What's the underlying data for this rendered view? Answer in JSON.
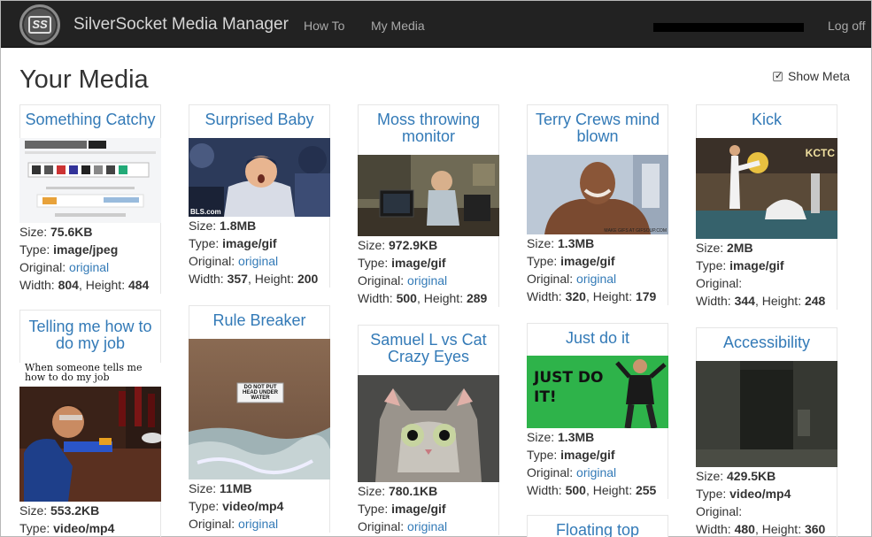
{
  "nav": {
    "logo_text": "SS",
    "brand": "SilverSocket Media Manager",
    "links": [
      "How To",
      "My Media"
    ],
    "logoff": "Log off"
  },
  "page": {
    "title": "Your Media",
    "show_meta": "Show Meta"
  },
  "labels": {
    "size": "Size:",
    "type": "Type:",
    "original": "Original:",
    "original_link": "original",
    "width": "Width:",
    "height": "Height:"
  },
  "media": [
    {
      "title": "Something Catchy",
      "size": "75.6KB",
      "type": "image/jpeg",
      "has_link": true,
      "width": "804",
      "height": "484"
    },
    {
      "title": "Surprised Baby",
      "size": "1.8MB",
      "type": "image/gif",
      "has_link": true,
      "width": "357",
      "height": "200",
      "overlay": "BLS.com"
    },
    {
      "title": "Moss throwing monitor",
      "size": "972.9KB",
      "type": "image/gif",
      "has_link": true,
      "width": "500",
      "height": "289"
    },
    {
      "title": "Terry Crews mind blown",
      "size": "1.3MB",
      "type": "image/gif",
      "has_link": true,
      "width": "320",
      "height": "179",
      "overlay": "MAKE GIFS AT GIFSOUP.COM"
    },
    {
      "title": "Kick",
      "size": "2MB",
      "type": "image/gif",
      "has_link": false,
      "width": "344",
      "height": "248",
      "overlay": "KCTC"
    },
    {
      "title": "Telling me how to do my job",
      "size": "553.2KB",
      "type": "video/mp4",
      "caption": "When someone tells me how to do my job"
    },
    {
      "title": "Rule Breaker",
      "size": "11MB",
      "type": "video/mp4",
      "has_link": true,
      "sign": "DO NOT PUT HEAD UNDER WATER"
    },
    {
      "title": "Samuel L vs Cat Crazy Eyes",
      "size": "780.1KB",
      "type": "image/gif",
      "has_link": true
    },
    {
      "title": "Just do it",
      "size": "1.3MB",
      "type": "image/gif",
      "has_link": true,
      "width": "500",
      "height": "255",
      "overlay": "JUST DO IT!"
    },
    {
      "title": "Accessibility",
      "size": "429.5KB",
      "type": "video/mp4",
      "has_link": false,
      "width": "480",
      "height": "360"
    },
    {
      "title": "Floating top"
    }
  ],
  "colors": {
    "navbar": "#222222",
    "link": "#337ab7",
    "text": "#333333"
  }
}
